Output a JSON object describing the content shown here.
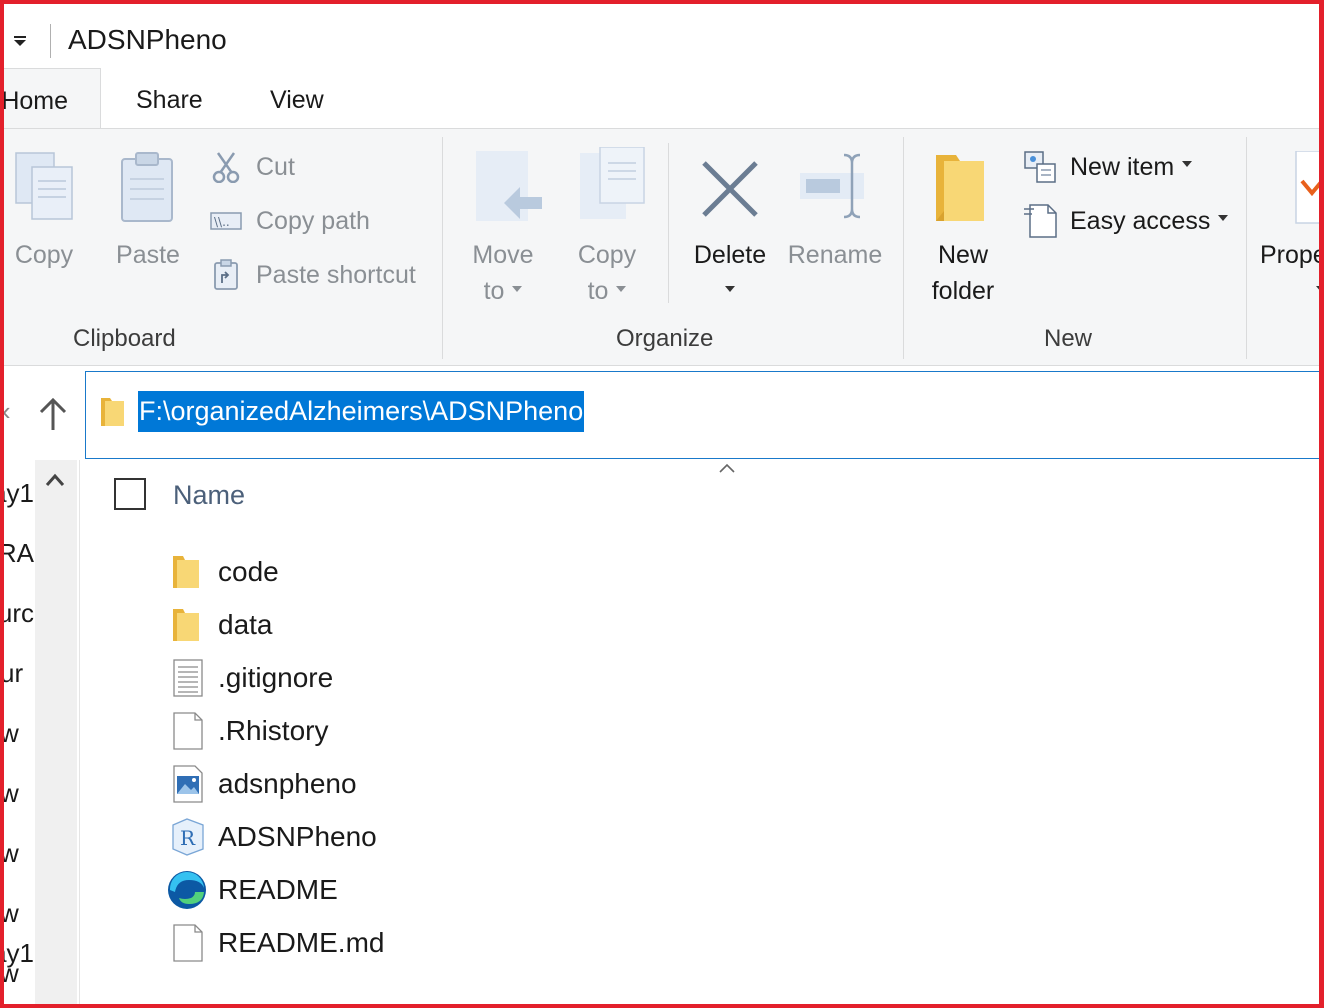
{
  "window": {
    "title": "ADSNPheno"
  },
  "tabs": [
    {
      "label": "Home"
    },
    {
      "label": "Share"
    },
    {
      "label": "View"
    }
  ],
  "ribbon": {
    "clipboard": {
      "group_label": "Clipboard",
      "copy_label": "Copy",
      "paste_label": "Paste",
      "cut_label": "Cut",
      "copy_path_label": "Copy path",
      "paste_shortcut_label": "Paste shortcut"
    },
    "organize": {
      "group_label": "Organize",
      "move_to_line1": "Move",
      "move_to_line2": "to",
      "copy_to_line1": "Copy",
      "copy_to_line2": "to",
      "delete_label": "Delete",
      "rename_label": "Rename"
    },
    "new": {
      "group_label": "New",
      "new_folder_line1": "New",
      "new_folder_line2": "folder",
      "new_item_label": "New item",
      "easy_access_label": "Easy access"
    },
    "open": {
      "properties_label": "Prope"
    }
  },
  "address": {
    "path": "F:\\organizedAlzheimers\\ADSNPheno"
  },
  "navpane": {
    "items": [
      "ay1",
      "RA",
      "urc",
      "ur",
      "w",
      "w",
      "w",
      "w",
      "w"
    ]
  },
  "content": {
    "column_header": "Name",
    "files": [
      {
        "name": "code",
        "icon": "folder-icon"
      },
      {
        "name": "data",
        "icon": "folder-icon"
      },
      {
        "name": ".gitignore",
        "icon": "text-file-icon"
      },
      {
        "name": ".Rhistory",
        "icon": "blank-file-icon"
      },
      {
        "name": "adsnpheno",
        "icon": "image-file-icon"
      },
      {
        "name": "ADSNPheno",
        "icon": "r-project-icon"
      },
      {
        "name": "README",
        "icon": "edge-icon"
      },
      {
        "name": "README.md",
        "icon": "blank-file-icon"
      }
    ]
  },
  "colors": {
    "accent": "#0078d7",
    "frame": "#e3202b",
    "ribbon_bg": "#f5f6f7",
    "folder": "#f8d775"
  }
}
